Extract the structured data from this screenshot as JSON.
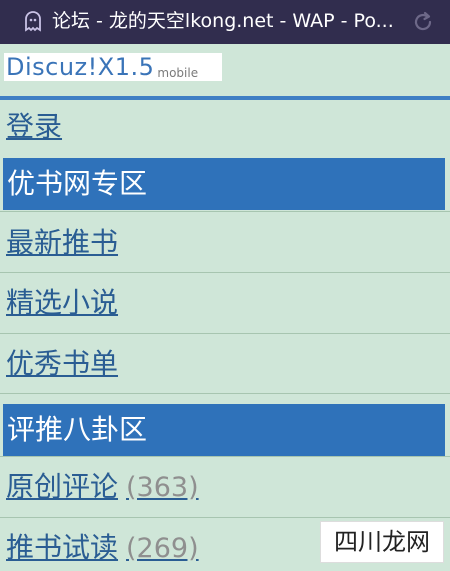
{
  "browser": {
    "title": "论坛 - 龙的天空lkong.net - WAP - Po..."
  },
  "logo": {
    "main": "Discuz!X1.5",
    "sub": "mobile"
  },
  "nav": {
    "login": "登录"
  },
  "sections": [
    {
      "title": "优书网专区",
      "items": [
        {
          "label": "最新推书"
        },
        {
          "label": "精选小说"
        },
        {
          "label": "优秀书单"
        }
      ]
    },
    {
      "title": "评推八卦区",
      "items": [
        {
          "label": "原创评论",
          "count": "(363)"
        },
        {
          "label": "推书试读",
          "count": "(269)"
        }
      ]
    }
  ],
  "watermark": {
    "text": "四川龙网"
  },
  "colors": {
    "topbar": "#312d4e",
    "background": "#cfe6d8",
    "section": "#2f72ba",
    "link": "#2a5d93",
    "count": "#8f8f8f"
  }
}
